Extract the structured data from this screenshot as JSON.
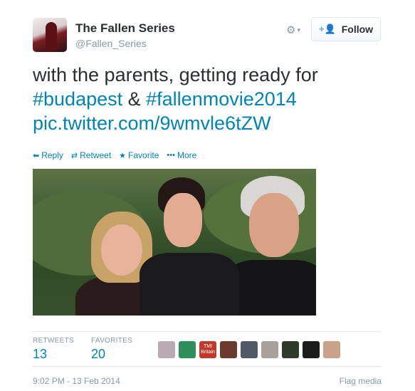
{
  "user": {
    "name": "The Fallen Series",
    "handle": "@Fallen_Series"
  },
  "header": {
    "gear_icon": "⚙",
    "caret_icon": "▾",
    "follow_icon": "+👤",
    "follow_label": "Follow"
  },
  "tweet": {
    "text_part1": "with the parents, getting ready for ",
    "hashtag1": "#budapest",
    "text_part2": " & ",
    "hashtag2": "#fallenmovie2014",
    "link": "pic.twitter.com/9wmvle6tZW"
  },
  "actions": [
    {
      "icon": "⬅",
      "label": "Reply"
    },
    {
      "icon": "⇄",
      "label": "Retweet"
    },
    {
      "icon": "★",
      "label": "Favorite"
    },
    {
      "icon": "•••",
      "label": "More"
    }
  ],
  "stats": {
    "retweets_label": "RETWEETS",
    "retweets_value": "13",
    "favorites_label": "FAVORITES",
    "favorites_value": "20"
  },
  "favoriter_avatars": [
    {
      "bg": "#b9a9b0",
      "text": ""
    },
    {
      "bg": "#2f8f5a",
      "text": ""
    },
    {
      "bg": "#c0392b",
      "text": "TMI Britain"
    },
    {
      "bg": "#6b3a2e",
      "text": ""
    },
    {
      "bg": "#4f5a66",
      "text": ""
    },
    {
      "bg": "#a8a29a",
      "text": ""
    },
    {
      "bg": "#2f3a2a",
      "text": ""
    },
    {
      "bg": "#1c1c1c",
      "text": ""
    },
    {
      "bg": "#c9a28c",
      "text": ""
    }
  ],
  "footer": {
    "timestamp": "9:02 PM - 13 Feb 2014",
    "flag_label": "Flag media"
  },
  "colors": {
    "link": "#0084b4",
    "text": "#292f33",
    "muted": "#8899a6",
    "accent": "#55acee"
  }
}
